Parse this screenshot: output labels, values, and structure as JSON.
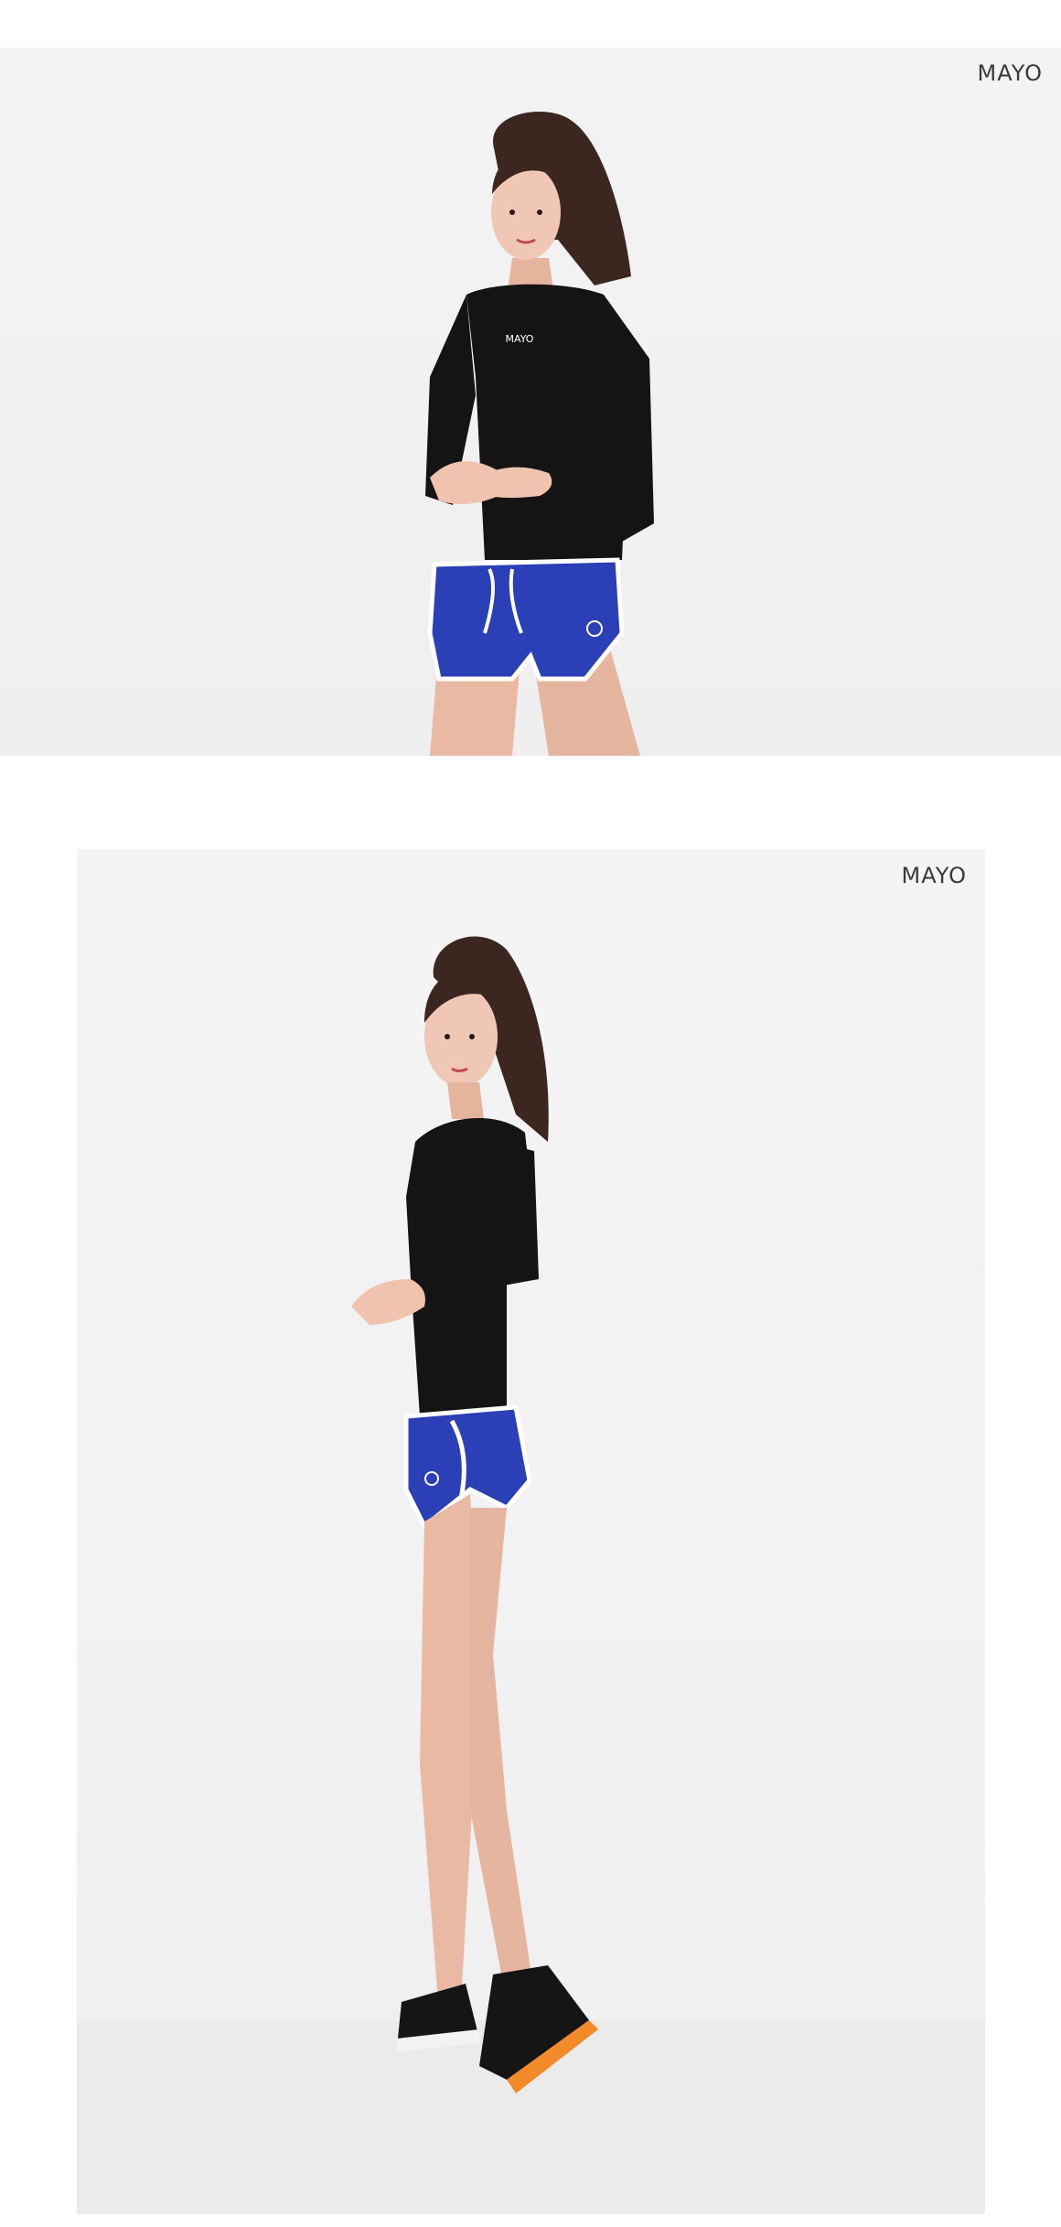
{
  "photos": [
    {
      "brand_logo": "MAYO",
      "shirt_print": "MAYO"
    },
    {
      "brand_logo": "MAYO"
    }
  ],
  "colors": {
    "background": "#ffffff",
    "backdrop": "#f2f2f2",
    "shirt": "#141414",
    "shorts": "#2b3fb6",
    "trim": "#ffffff",
    "sneaker_accent": "#f28a2a"
  }
}
